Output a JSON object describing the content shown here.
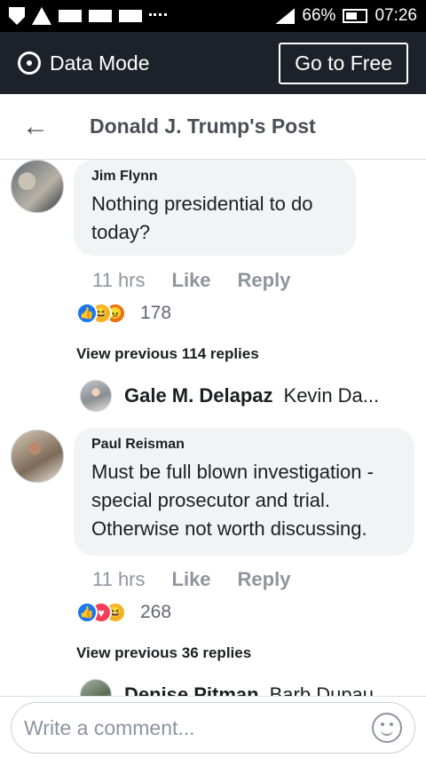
{
  "status_bar": {
    "battery": "66%",
    "time": "07:26"
  },
  "data_mode": {
    "label": "Data Mode",
    "button": "Go to Free"
  },
  "header": {
    "title": "Donald J. Trump's Post"
  },
  "comments": [
    {
      "name": "Jim Flynn",
      "text": "Nothing presidential to do today?",
      "time": "11 hrs",
      "like": "Like",
      "reply": "Reply",
      "reaction_count": "178",
      "view_previous": "View previous 114 replies",
      "reply_preview": {
        "name": "Gale M. Delapaz",
        "text": "Kevin Da..."
      }
    },
    {
      "name": "Paul Reisman",
      "text": "Must be full blown investigation - special prosecutor and trial. Otherwise not worth discussing.",
      "time": "11 hrs",
      "like": "Like",
      "reply": "Reply",
      "reaction_count": "268",
      "view_previous": "View previous 36 replies",
      "reply_preview": {
        "name": "Denise Pitman",
        "text": "Barb Dupau"
      }
    }
  ],
  "composer": {
    "placeholder": "Write a comment..."
  }
}
